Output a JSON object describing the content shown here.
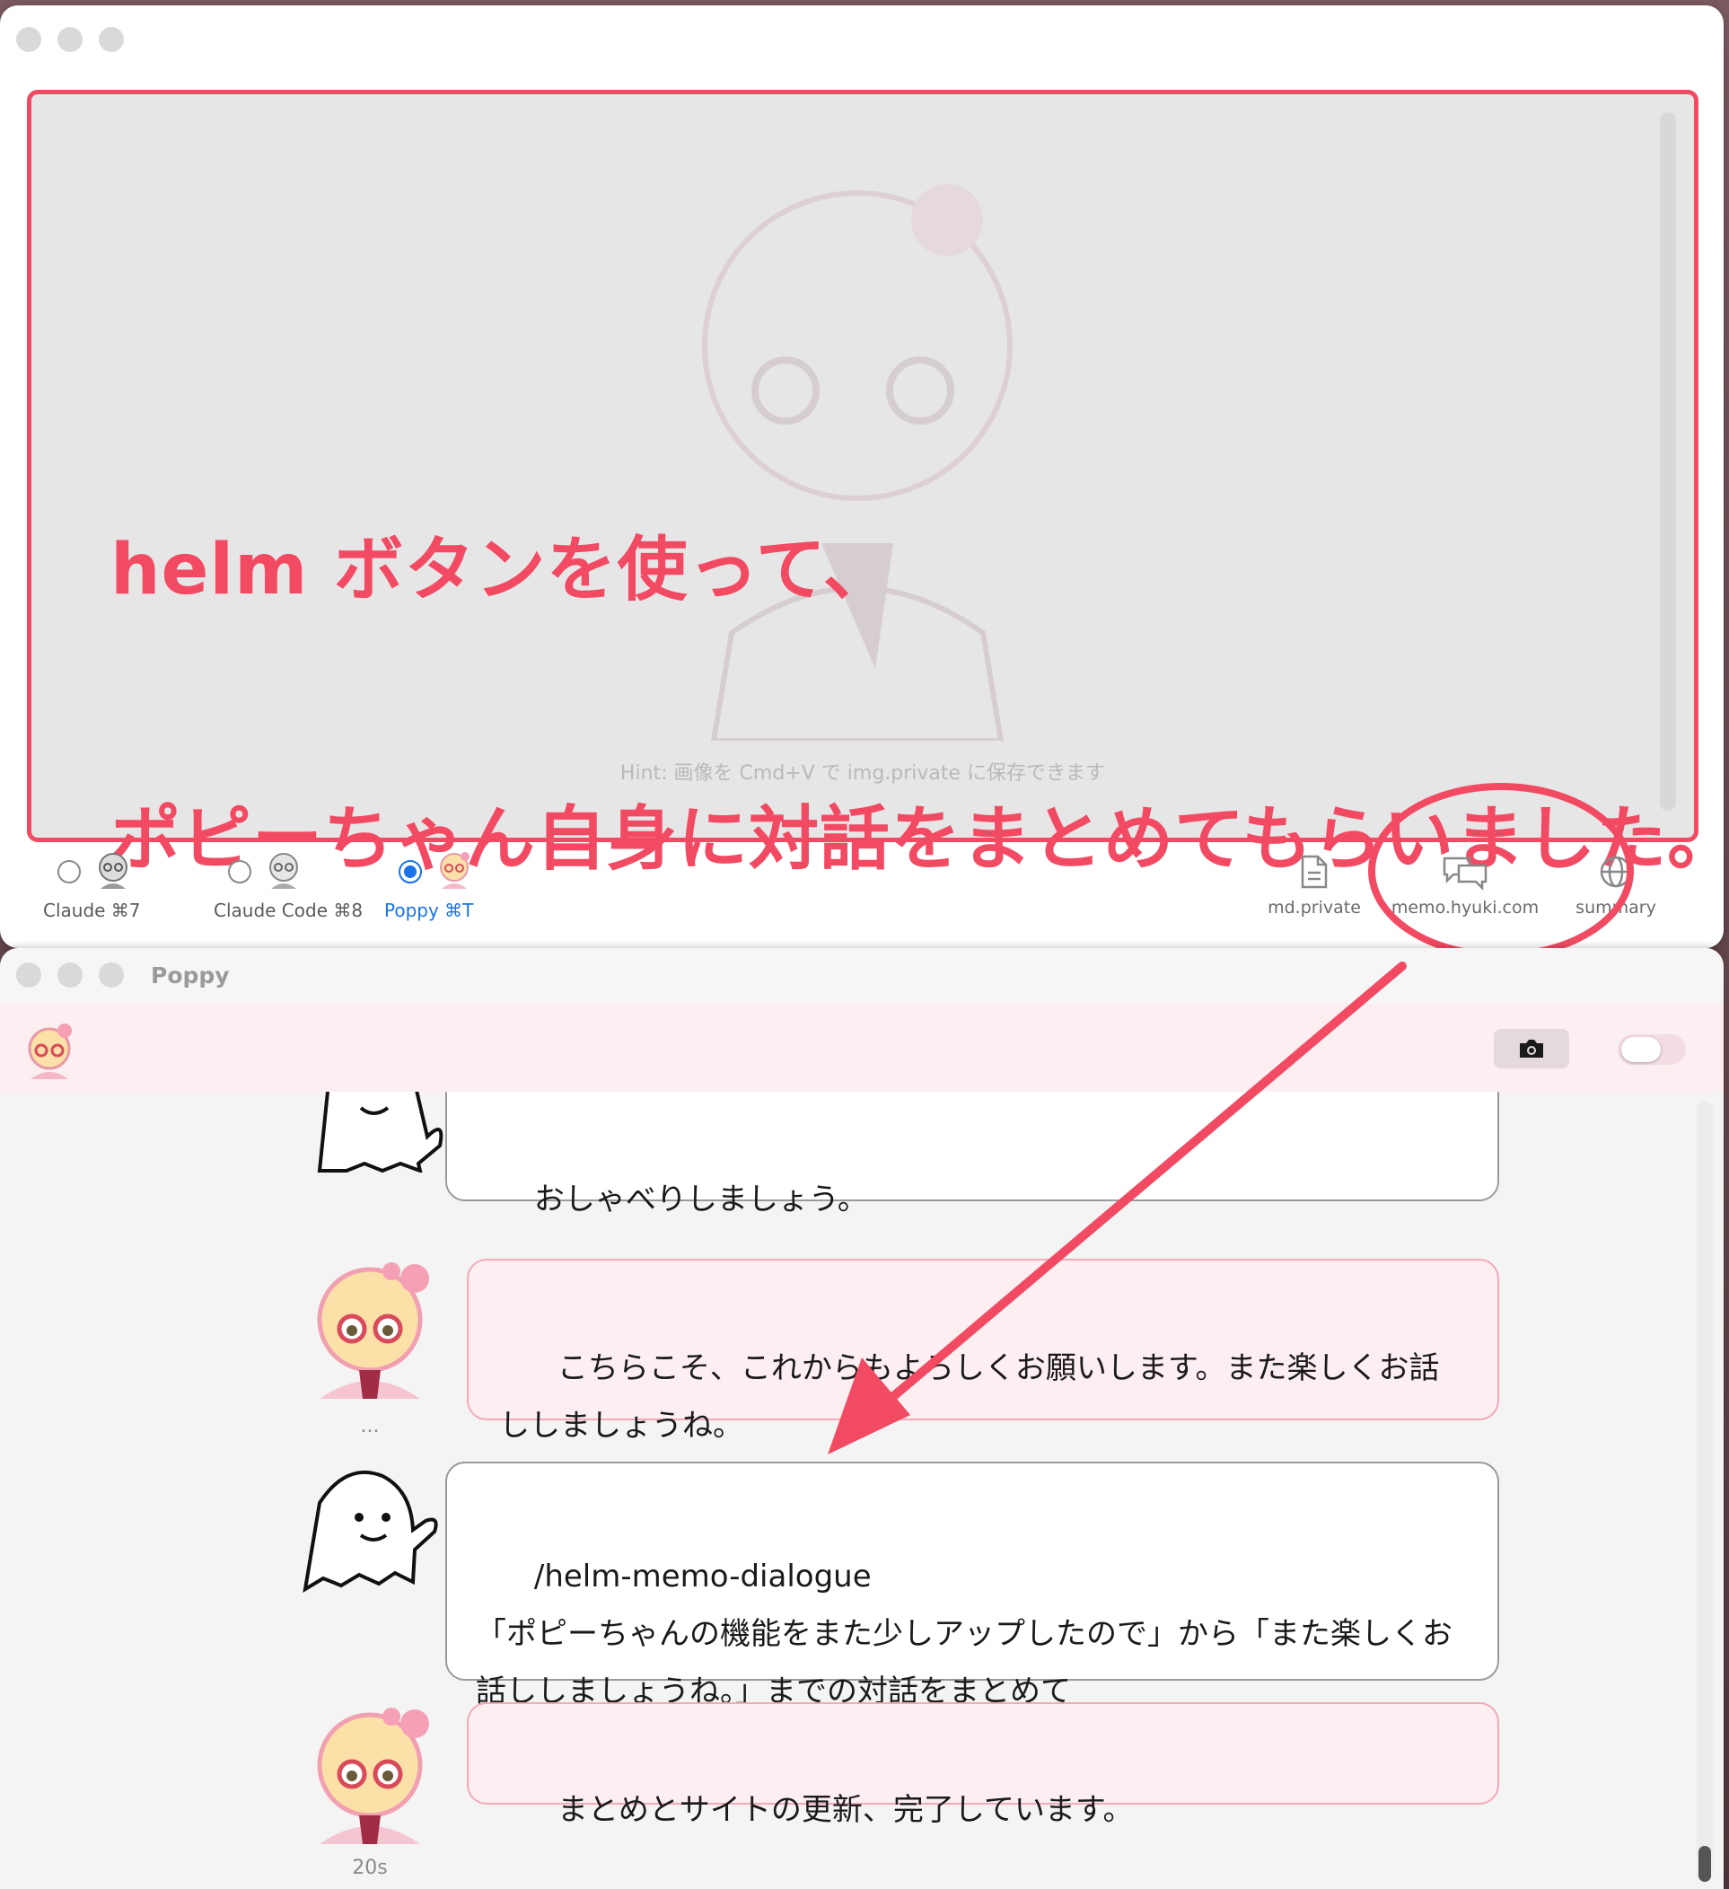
{
  "top_window": {
    "editor": {
      "hint": "Hint: 画像を Cmd+V で img.private に保存できます",
      "annotation_line1": "helm ボタンを使って、",
      "annotation_line2": "ポピーちゃん自身に対話をまとめてもらいました。"
    },
    "modes": [
      {
        "label": "Claude ⌘7",
        "selected": false
      },
      {
        "label": "Claude Code ⌘8",
        "selected": false
      },
      {
        "label": "Poppy ⌘T",
        "selected": true
      }
    ],
    "tools": [
      {
        "label": "md.private",
        "icon": "document-icon"
      },
      {
        "label": "memo.hyuki.com",
        "icon": "chat-bubbles-icon"
      },
      {
        "label": "summary",
        "icon": "globe-icon"
      }
    ]
  },
  "bottom_window": {
    "title": "Poppy",
    "messages": [
      {
        "role": "user",
        "text": "おしゃべりしましょう。"
      },
      {
        "role": "assistant",
        "text": "こちらこそ、これからもよろしくお願いします。また楽しくお話ししましょうね。",
        "meta": "..."
      },
      {
        "role": "user",
        "text": "/helm-memo-dialogue\n「ポピーちゃんの機能をまた少しアップしたので」から「また楽しくお話ししましょうね。」までの対話をまとめて"
      },
      {
        "role": "assistant",
        "text": "まとめとサイトの更新、完了しています。",
        "meta": "20s"
      }
    ]
  },
  "colors": {
    "annotation_red": "#f24a63",
    "accent_blue": "#1a73e8",
    "assistant_bubble": "#fdeef1"
  }
}
